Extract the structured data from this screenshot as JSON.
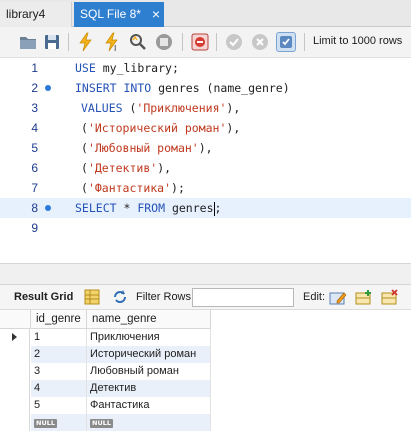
{
  "tabs": [
    {
      "label": "library4",
      "active": false
    },
    {
      "label": "SQL File 8*",
      "active": true,
      "close": "×"
    }
  ],
  "toolbar": {
    "icons": [
      "open-folder-icon",
      "save-icon",
      "execute-icon",
      "execute-current-icon",
      "explain-icon",
      "stop-icon",
      "toggle-error-icon",
      "commit-icon",
      "rollback-icon",
      "autocommit-icon"
    ],
    "limit_label": "Limit to 1000 rows"
  },
  "editor": {
    "lines": [
      {
        "num": "1",
        "dot": false
      },
      {
        "num": "2",
        "dot": true
      },
      {
        "num": "3",
        "dot": false
      },
      {
        "num": "4",
        "dot": false
      },
      {
        "num": "5",
        "dot": false
      },
      {
        "num": "6",
        "dot": false
      },
      {
        "num": "7",
        "dot": false
      },
      {
        "num": "8",
        "dot": true
      },
      {
        "num": "9",
        "dot": false
      }
    ],
    "code": {
      "l1_kw": "USE",
      "l1_rest": " my_library;",
      "l2_kw": "INSERT INTO",
      "l2_rest": " genres (name_genre)",
      "l3_kw": "VALUES",
      "l3_rest_a": " (",
      "l3_str": "'Приключения'",
      "l3_rest_b": "),",
      "l4_a": "(",
      "l4_str": "'Исторический роман'",
      "l4_b": "),",
      "l5_a": "(",
      "l5_str": "'Любовный роман'",
      "l5_b": "),",
      "l6_a": "(",
      "l6_str": "'Детектив'",
      "l6_b": "),",
      "l7_a": "(",
      "l7_str": "'Фантастика'",
      "l7_b": ");",
      "l8_kw1": "SELECT",
      "l8_mid": " * ",
      "l8_kw2": "FROM",
      "l8_rest": " genres",
      "l8_end": ";"
    },
    "current_line": "8"
  },
  "result": {
    "grid_label": "Result Grid",
    "filter_label": "Filter Rows:",
    "filter_value": "",
    "edit_label": "Edit:",
    "columns": [
      "id_genre",
      "name_genre"
    ],
    "rows": [
      [
        "1",
        "Приключения"
      ],
      [
        "2",
        "Исторический роман"
      ],
      [
        "3",
        "Любовный роман"
      ],
      [
        "4",
        "Детектив"
      ],
      [
        "5",
        "Фантастика"
      ]
    ],
    "null_label": "NULL"
  },
  "colors": {
    "tab_active": "#2f7fd0",
    "keyword": "#2452b6",
    "string": "#c0391f",
    "line_number": "#1d3b8f"
  }
}
